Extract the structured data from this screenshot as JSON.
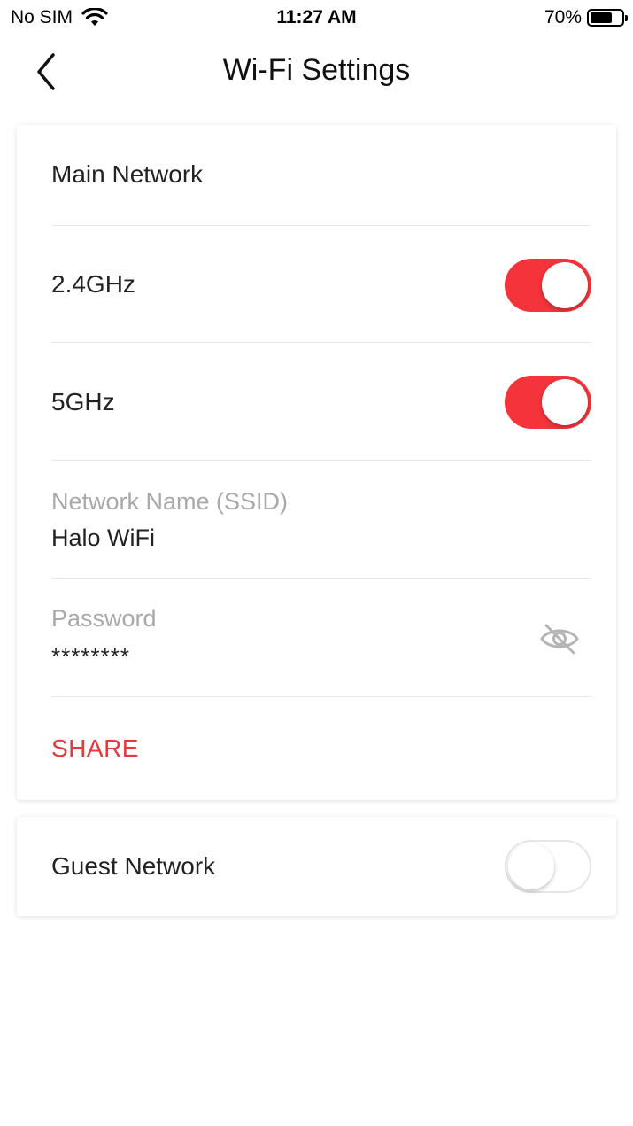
{
  "status_bar": {
    "carrier": "No SIM",
    "time": "11:27 AM",
    "battery_percent": "70%",
    "battery_level": 0.7,
    "wifi_icon": "wifi-icon",
    "battery_icon": "battery-icon"
  },
  "nav": {
    "title": "Wi-Fi Settings",
    "back_icon": "chevron-left-icon"
  },
  "main_network": {
    "title": "Main Network",
    "band_24": {
      "label": "2.4GHz",
      "enabled": true
    },
    "band_5": {
      "label": "5GHz",
      "enabled": true
    },
    "ssid": {
      "label": "Network Name (SSID)",
      "value": "Halo WiFi"
    },
    "password": {
      "label": "Password",
      "value": "********",
      "visibility_icon": "eye-slash-icon"
    },
    "share_label": "SHARE"
  },
  "guest_network": {
    "title": "Guest Network",
    "enabled": false
  },
  "colors": {
    "accent": "#f5333a",
    "share": "#e8383d",
    "muted_label": "#a9a9a9"
  }
}
